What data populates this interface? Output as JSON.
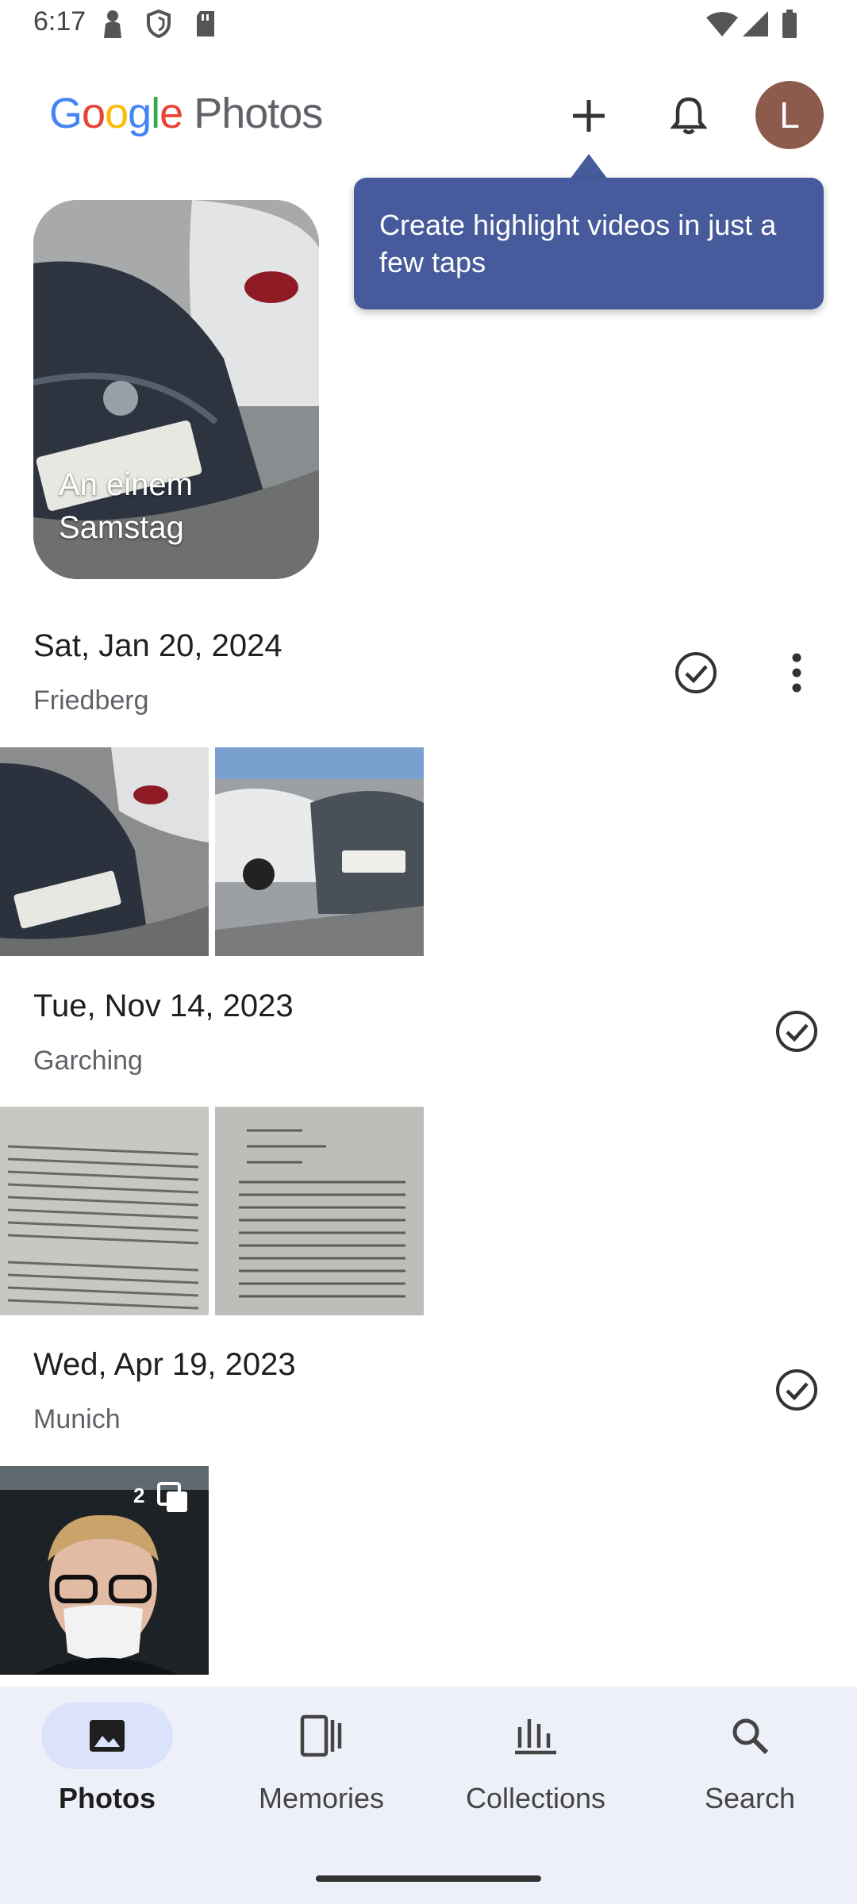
{
  "status_bar": {
    "time": "6:17"
  },
  "header": {
    "logo_word": "Google",
    "logo_product": "Photos",
    "avatar_letter": "L",
    "avatar_color": "#8d5b4c"
  },
  "tooltip": {
    "text": "Create highlight videos in just a few taps"
  },
  "memory": {
    "label": "An einem Samstag"
  },
  "groups": [
    {
      "date": "Sat, Jan 20, 2024",
      "place": "Friedberg"
    },
    {
      "date": "Tue, Nov 14, 2023",
      "place": "Garching"
    },
    {
      "date": "Wed, Apr 19, 2023",
      "place": "Munich"
    }
  ],
  "stack_badge": {
    "count": "2"
  },
  "nav": {
    "items": [
      {
        "label": "Photos",
        "icon": "photo-icon",
        "active": true
      },
      {
        "label": "Memories",
        "icon": "memories-icon",
        "active": false
      },
      {
        "label": "Collections",
        "icon": "collections-icon",
        "active": false
      },
      {
        "label": "Search",
        "icon": "search-icon",
        "active": false
      }
    ]
  },
  "colors": {
    "tooltip_bg": "#465a9c",
    "nav_bg": "#eef0f9",
    "nav_active_pill": "#dbe2fb"
  }
}
